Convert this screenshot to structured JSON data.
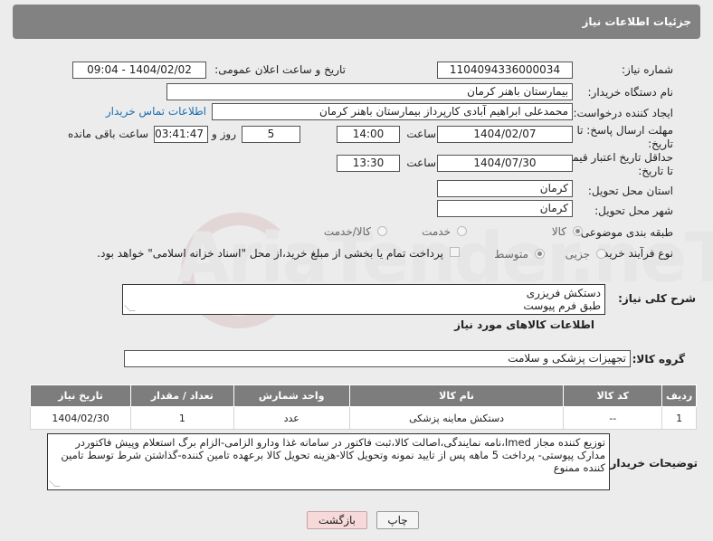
{
  "header": {
    "title": "جزئیات اطلاعات نیاز"
  },
  "fields": {
    "need_number_label": "شماره نیاز:",
    "need_number": "1104094336000034",
    "announce_label": "تاریخ و ساعت اعلان عمومی:",
    "announce_value": "1404/02/02 - 09:04",
    "buyer_org_label": "نام دستگاه خریدار:",
    "buyer_org": "بیمارستان باهنر کرمان",
    "requester_label": "ایجاد کننده درخواست:",
    "requester": "محمدعلی ابراهیم آبادی کارپرداز بیمارستان باهنر کرمان",
    "contact_link": "اطلاعات تماس خریدار",
    "reply_deadline_label_1": "مهلت ارسال پاسخ: تا",
    "reply_deadline_label_2": "تاریخ:",
    "reply_date": "1404/02/07",
    "time_label": "ساعت",
    "reply_time": "14:00",
    "days_value": "5",
    "days_label": "روز و",
    "remaining_time": "03:41:47",
    "remaining_label": "ساعت باقی مانده",
    "price_validity_label_1": "حداقل تاریخ اعتبار قیمت:",
    "price_validity_label_2": "تا تاریخ:",
    "validity_date": "1404/07/30",
    "validity_time": "13:30",
    "delivery_province_label": "استان محل تحویل:",
    "delivery_province": "کرمان",
    "delivery_city_label": "شهر محل تحویل:",
    "delivery_city": "کرمان",
    "category_label": "طبقه بندی موضوعی:",
    "category_options": [
      "کالا",
      "خدمت",
      "کالا/خدمت"
    ],
    "category_selected": "کالا",
    "process_label": "نوع فرآیند خرید :",
    "process_options": [
      "جزیی",
      "متوسط"
    ],
    "process_selected": "متوسط",
    "payment_note": "پرداخت تمام یا بخشی از مبلغ خرید،از محل \"اسناد خزانه اسلامی\" خواهد بود."
  },
  "description": {
    "label": "شرح کلی نیاز:",
    "line1": "دستکش فریزری",
    "line2": "طبق فرم پیوست"
  },
  "goods_section": {
    "title": "اطلاعات کالاهای مورد نیاز",
    "group_label": "گروه کالا:",
    "group_value": "تجهیزات پزشکی و سلامت"
  },
  "table": {
    "headers": [
      "ردیف",
      "کد کالا",
      "نام کالا",
      "واحد شمارش",
      "تعداد / مقدار",
      "تاریخ نیاز"
    ],
    "rows": [
      [
        "1",
        "--",
        "دستکش معاینه پزشکی",
        "عدد",
        "1",
        "1404/02/30"
      ]
    ]
  },
  "buyer_notes": {
    "label": "توضیحات خریدار:",
    "text": "توزیع کننده مجاز Imed،نامه نمایندگی،اصالت کالا،ثبت فاکتور در سامانه غذا ودارو الزامی-الزام برگ استعلام وپیش فاکتوردر مدارک پیوستی- پرداخت 5 ماهه پس از تایید نمونه وتحویل کالا-هزینه تحویل کالا برعهده تامین کننده-گذاشتن شرط توسط تامین کننده ممنوع"
  },
  "buttons": {
    "print": "چاپ",
    "back": "بازگشت"
  },
  "watermark": "AriaTender.neT"
}
